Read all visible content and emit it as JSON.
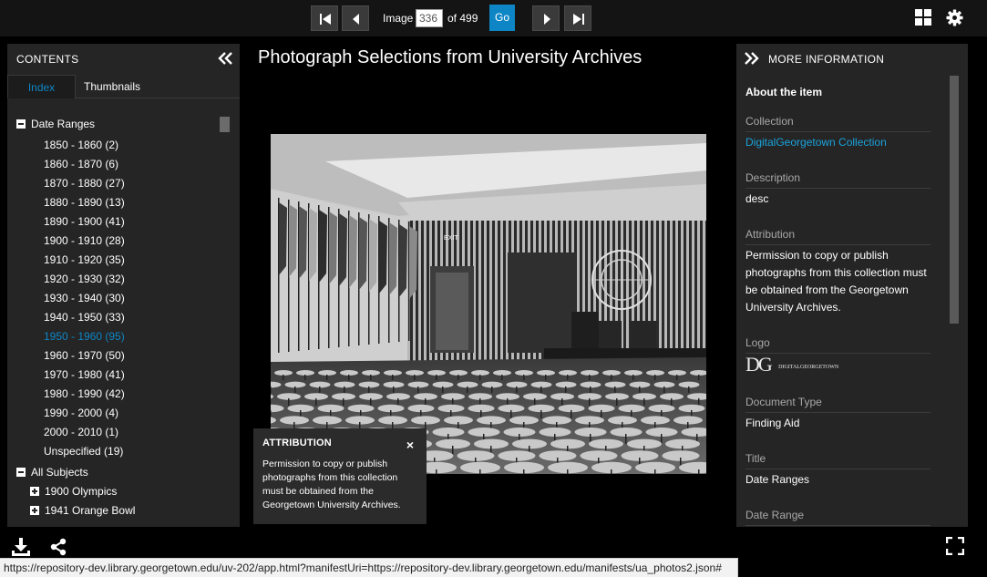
{
  "toolbar": {
    "image_label": "Image",
    "image_value": "336",
    "of_label": "of 499",
    "go_label": "Go",
    "icons": [
      "first-page-icon",
      "previous-page-icon",
      "next-page-icon",
      "last-page-icon",
      "gallery-grid-icon",
      "settings-gear-icon"
    ]
  },
  "contents": {
    "title": "CONTENTS",
    "tabs": [
      "Index",
      "Thumbnails"
    ],
    "active_tab": "Index",
    "root": "Date Ranges",
    "date_ranges": [
      "1850 - 1860 (2)",
      "1860 - 1870 (6)",
      "1870 - 1880 (27)",
      "1880 - 1890 (13)",
      "1890 - 1900 (41)",
      "1900 - 1910 (28)",
      "1910 - 1920 (35)",
      "1920 - 1930 (32)",
      "1930 - 1940 (30)",
      "1940 - 1950 (33)",
      "1950 - 1960 (95)",
      "1960 - 1970 (50)",
      "1970 - 1980 (41)",
      "1980 - 1990 (42)",
      "1990 - 2000 (4)",
      "2000 - 2010 (1)",
      "Unspecified (19)"
    ],
    "selected_range": "1950 - 1960 (95)",
    "subjects_root": "All Subjects",
    "subjects": [
      "1900 Olympics",
      "1941 Orange Bowl"
    ]
  },
  "viewer": {
    "title": "Photograph Selections from University Archives",
    "photo_sign": "EXIT"
  },
  "attribution_popup": {
    "title": "ATTRIBUTION",
    "close": "×",
    "text": "Permission to copy or publish photographs from this collection must be obtained from the Georgetown University Archives."
  },
  "more_info": {
    "title": "MORE INFORMATION",
    "heading": "About the item",
    "fields": [
      {
        "label": "Collection",
        "value": "DigitalGeorgetown Collection"
      },
      {
        "label": "Description",
        "value": "desc"
      },
      {
        "label": "Attribution",
        "value": "Permission to copy or publish photographs from this collection must be obtained from the Georgetown University Archives."
      },
      {
        "label": "Logo",
        "value": ""
      },
      {
        "label": "Document Type",
        "value": "Finding Aid"
      },
      {
        "label": "Title",
        "value": "Date Ranges"
      },
      {
        "label": "Date Range",
        "value": ""
      }
    ],
    "logo": {
      "initials": "DG",
      "wordmark": "DIGITALGEORGETOWN"
    }
  },
  "status_bar": {
    "url": "https://repository-dev.library.georgetown.edu/uv-202/app.html?manifestUri=https://repository-dev.library.georgetown.edu/manifests/ua_photos2.json#"
  },
  "colors": {
    "accent": "#0e86c5",
    "link": "#1aa3dc",
    "panel": "#252525",
    "background": "#000000"
  }
}
